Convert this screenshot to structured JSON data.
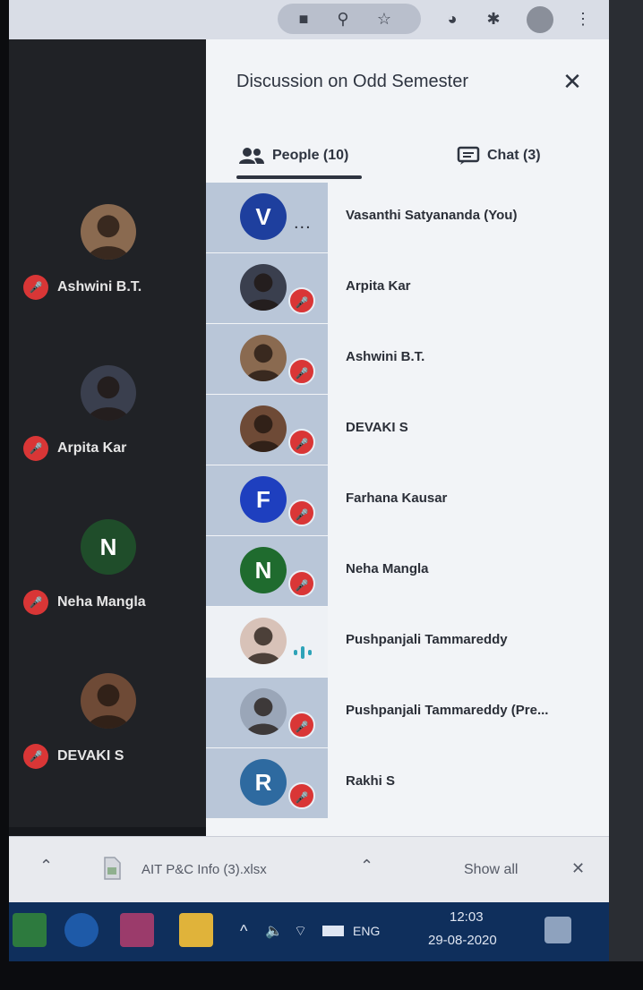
{
  "panel": {
    "title": "Discussion on Odd Semester",
    "close_icon": "close-icon",
    "tabs": [
      {
        "label": "People (10)",
        "icon": "people-icon",
        "active": true
      },
      {
        "label": "Chat (3)",
        "icon": "chat-icon",
        "active": false
      }
    ]
  },
  "people": [
    {
      "name": "Vasanthi Satyananda (You)",
      "avatar": "V",
      "avatar_color": "#1e3f9e",
      "status": "more"
    },
    {
      "name": "Arpita Kar",
      "avatar": "photo",
      "avatar_color": "#3a3f4e",
      "status": "muted"
    },
    {
      "name": "Ashwini B.T.",
      "avatar": "photo",
      "avatar_color": "#8a6a50",
      "status": "muted"
    },
    {
      "name": "DEVAKI S",
      "avatar": "photo",
      "avatar_color": "#6e4a36",
      "status": "muted"
    },
    {
      "name": "Farhana Kausar",
      "avatar": "F",
      "avatar_color": "#1e3fbf",
      "status": "muted"
    },
    {
      "name": "Neha Mangla",
      "avatar": "N",
      "avatar_color": "#1f6b2e",
      "status": "muted"
    },
    {
      "name": "Pushpanjali Tammareddy",
      "avatar": "photo",
      "avatar_color": "#d8c2b8",
      "status": "speaking"
    },
    {
      "name": "Pushpanjali Tammareddy (Pre...",
      "avatar": "photo",
      "avatar_color": "#9aa6b8",
      "status": "muted"
    },
    {
      "name": "Rakhi S",
      "avatar": "R",
      "avatar_color": "#2e6aa0",
      "status": "muted"
    }
  ],
  "tiles": [
    {
      "name": "Ashwini B.T.",
      "avatar": "photo",
      "avatar_color": "#8a6a50"
    },
    {
      "name": "Arpita Kar",
      "avatar": "photo",
      "avatar_color": "#3a3f4e"
    },
    {
      "name": "Neha Mangla",
      "avatar": "N",
      "avatar_color": "#1f4d2a"
    },
    {
      "name": "DEVAKI S",
      "avatar": "photo",
      "avatar_color": "#6e4a36"
    }
  ],
  "downloads": {
    "file_name": "AIT P&C Info (3).xlsx",
    "show_all_label": "Show all"
  },
  "taskbar": {
    "language": "ENG",
    "time": "12:03",
    "date": "29-08-2020"
  },
  "colors": {
    "mute_red": "#d93636",
    "panel_bg": "#f2f4f7",
    "taskbar_bg": "#0f2f5c"
  }
}
